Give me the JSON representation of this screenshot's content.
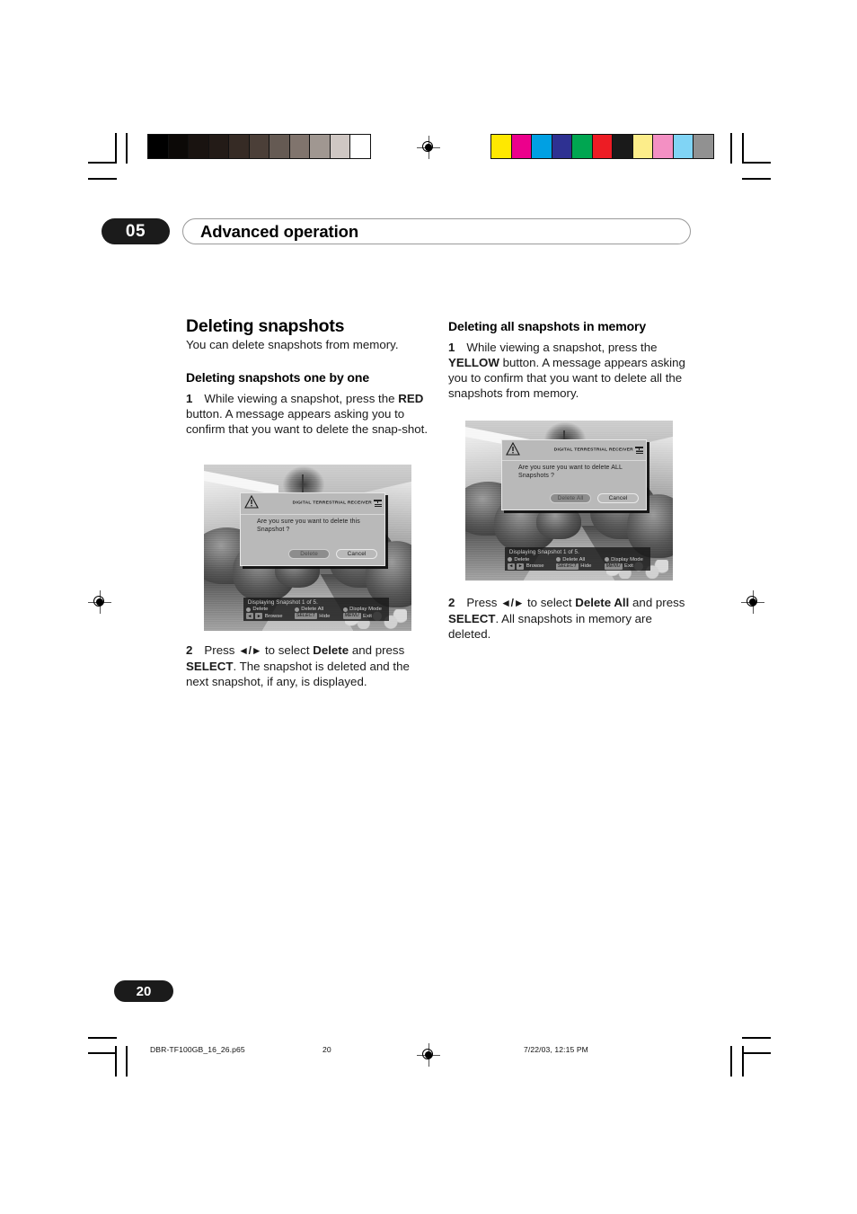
{
  "header": {
    "chapter_number": "05",
    "chapter_title": "Advanced operation"
  },
  "calibration": {
    "grayscale_bar": [
      "#000000",
      "#0c0907",
      "#191310",
      "#231b17",
      "#362b25",
      "#4b3f38",
      "#655a53",
      "#80746d",
      "#a09791",
      "#cfc7c3",
      "#ffffff"
    ],
    "color_bar": [
      "#ffe800",
      "#ec008c",
      "#00a0e3",
      "#2e3192",
      "#00a651",
      "#ed1c24",
      "#1a1a1a",
      "#fced8a",
      "#f390c3",
      "#80d4f5",
      "#919191"
    ]
  },
  "left_column": {
    "section_heading": "Deleting snapshots",
    "intro": "You can delete snapshots from memory.",
    "sub_heading": "Deleting snapshots one by one",
    "step1_number": "1",
    "step1_part1": "While viewing a snapshot, press the ",
    "step1_bold": "RED",
    "step1_part2": " button. A message appears asking you to confirm that you want to delete the snap-shot.",
    "step2_number": "2",
    "step2_part1": "Press ",
    "step2_arrows": "◄/►",
    "step2_part2": " to select ",
    "step2_bold1": "Delete",
    "step2_part3": " and press ",
    "step2_bold2": "SELECT",
    "step2_part4": ". The snapshot is deleted and the next snapshot, if any, is displayed."
  },
  "right_column": {
    "sub_heading": "Deleting all snapshots in memory",
    "step1_number": "1",
    "step1_part1": "While viewing a snapshot, press the ",
    "step1_bold": "YELLOW",
    "step1_part2": " button. A message appears asking you to confirm that you want to delete all the snapshots from memory.",
    "step2_number": "2",
    "step2_part1": "Press ",
    "step2_arrows": "◄/►",
    "step2_part2": " to select ",
    "step2_bold1": "Delete All",
    "step2_part3": " and press ",
    "step2_bold2": "SELECT",
    "step2_part4": ". All snapshots in memory are deleted."
  },
  "screenshot_single": {
    "brand": "DIGITAL TERRESTRIAL RECEIVER",
    "message": "Are you sure you want to delete this Snapshot ?",
    "primary_button": "Delete",
    "secondary_button": "Cancel",
    "banner_title": "Displaying Snapshot 1 of 5.",
    "banner_delete": "Delete",
    "banner_delete_all": "Delete All",
    "banner_display_mode": "Display Mode",
    "banner_browse": "Browse",
    "banner_select_key": "SELECT",
    "banner_hide": "Hide",
    "banner_menu_key": "MENU",
    "banner_exit": "Exit",
    "arrow_left": "◄",
    "arrow_right": "►"
  },
  "screenshot_all": {
    "brand": "DIGITAL TERRESTRIAL RECEIVER",
    "message": "Are you sure you want to delete ALL Snapshots ?",
    "primary_button": "Delete All",
    "secondary_button": "Cancel",
    "banner_title": "Displaying Snapshot 1 of 5.",
    "banner_delete": "Delete",
    "banner_delete_all": "Delete All",
    "banner_display_mode": "Display Mode",
    "banner_browse": "Browse",
    "banner_select_key": "SELECT",
    "banner_hide": "Hide",
    "banner_menu_key": "MENU",
    "banner_exit": "Exit",
    "arrow_left": "◄",
    "arrow_right": "►"
  },
  "footer": {
    "page_number": "20",
    "file_name": "DBR-TF100GB_16_26.p65",
    "slug_page": "20",
    "timestamp": "7/22/03, 12:15 PM"
  }
}
